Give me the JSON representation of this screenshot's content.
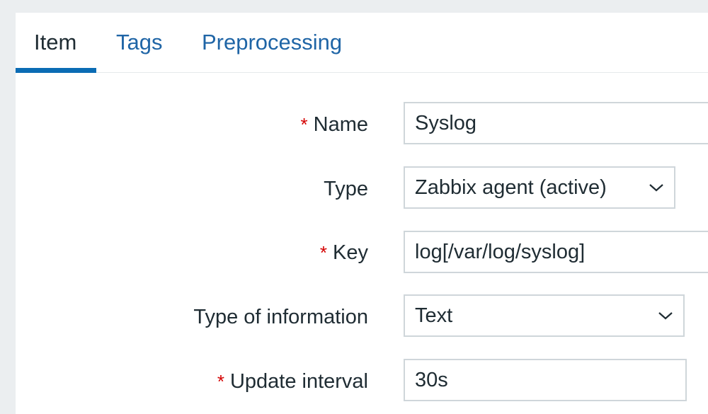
{
  "tabs": [
    {
      "label": "Item",
      "active": true
    },
    {
      "label": "Tags",
      "active": false
    },
    {
      "label": "Preprocessing",
      "active": false
    }
  ],
  "form": {
    "required_marker": "*",
    "name": {
      "label": "Name",
      "required": true,
      "value": "Syslog"
    },
    "type": {
      "label": "Type",
      "required": false,
      "value": "Zabbix agent (active)"
    },
    "key": {
      "label": "Key",
      "required": true,
      "value": "log[/var/log/syslog]"
    },
    "type_of_information": {
      "label": "Type of information",
      "required": false,
      "value": "Text"
    },
    "update_interval": {
      "label": "Update interval",
      "required": true,
      "value": "30s"
    }
  },
  "colors": {
    "page_bg": "#ebeef0",
    "panel_bg": "#ffffff",
    "link": "#1f65a6",
    "active_underline": "#0b6cb4",
    "required": "#d40000",
    "border": "#cfd6da",
    "text": "#1f2c33"
  },
  "icons": {
    "dropdown": "chevron-down-icon"
  }
}
